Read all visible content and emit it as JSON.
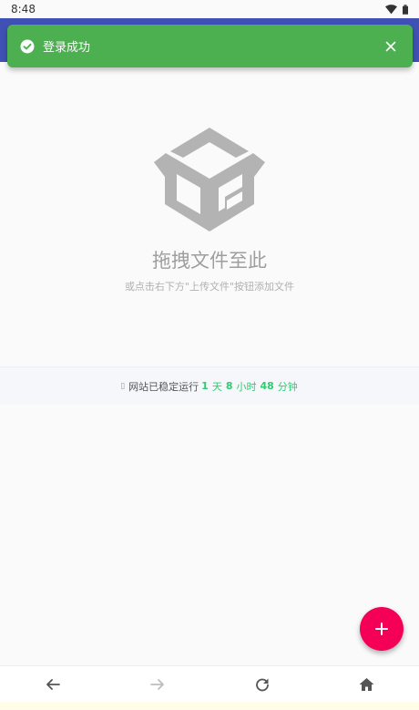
{
  "status_bar": {
    "time": "8:48",
    "wifi_icon": "wifi-icon",
    "battery_icon": "battery-icon"
  },
  "colors": {
    "app_bar": "#3f51b5",
    "toast": "#4caf50",
    "fab": "#f50057",
    "uptime_accent": "#2ecc71"
  },
  "toast": {
    "message": "登录成功",
    "icon": "check-circle-icon",
    "close_icon": "close-icon"
  },
  "drop_zone": {
    "icon": "box-icon",
    "title": "拖拽文件至此",
    "subtitle": "或点击右下方\"上传文件\"按钮添加文件"
  },
  "uptime": {
    "glyph": "▯",
    "label": "网站已稳定运行",
    "days": "1",
    "days_unit": "天",
    "hours": "8",
    "hours_unit": "小时",
    "minutes": "48",
    "minutes_unit": "分钟"
  },
  "fab": {
    "icon": "plus-icon"
  },
  "bottom_nav": {
    "back_icon": "arrow-left-icon",
    "forward_icon": "arrow-right-icon",
    "refresh_icon": "refresh-icon",
    "home_icon": "home-icon"
  }
}
